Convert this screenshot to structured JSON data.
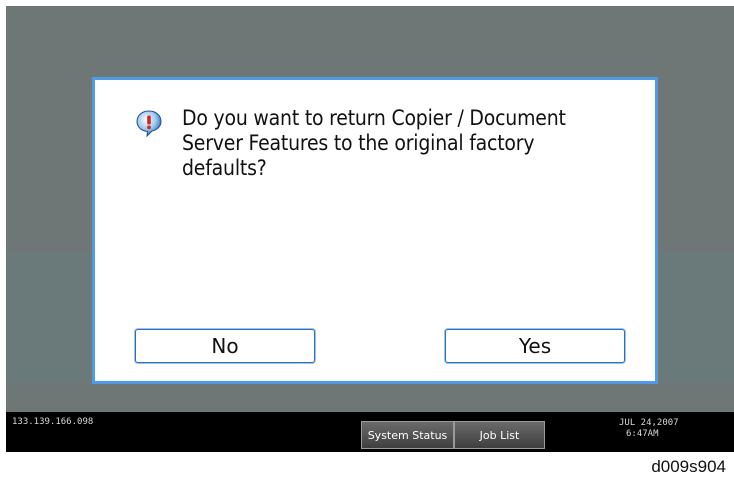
{
  "dialog": {
    "message_line1": "Do you want to return Copier / Document",
    "message_line2": "Server Features to the original factory",
    "message_line3": "defaults?",
    "no_label": "No",
    "yes_label": "Yes"
  },
  "statusbar": {
    "ip_address": "133.139.166.098",
    "system_status_label": "System Status",
    "job_list_label": "Job List",
    "date": "JUL  24,2007",
    "time": "6:47AM"
  },
  "figure_code": "d009s904",
  "colors": {
    "dialog_border": "#4f9be6",
    "screen_background": "#6e7775",
    "button_border": "#2f6fbf"
  },
  "icons": {
    "message_icon": "exclamation-icon"
  }
}
